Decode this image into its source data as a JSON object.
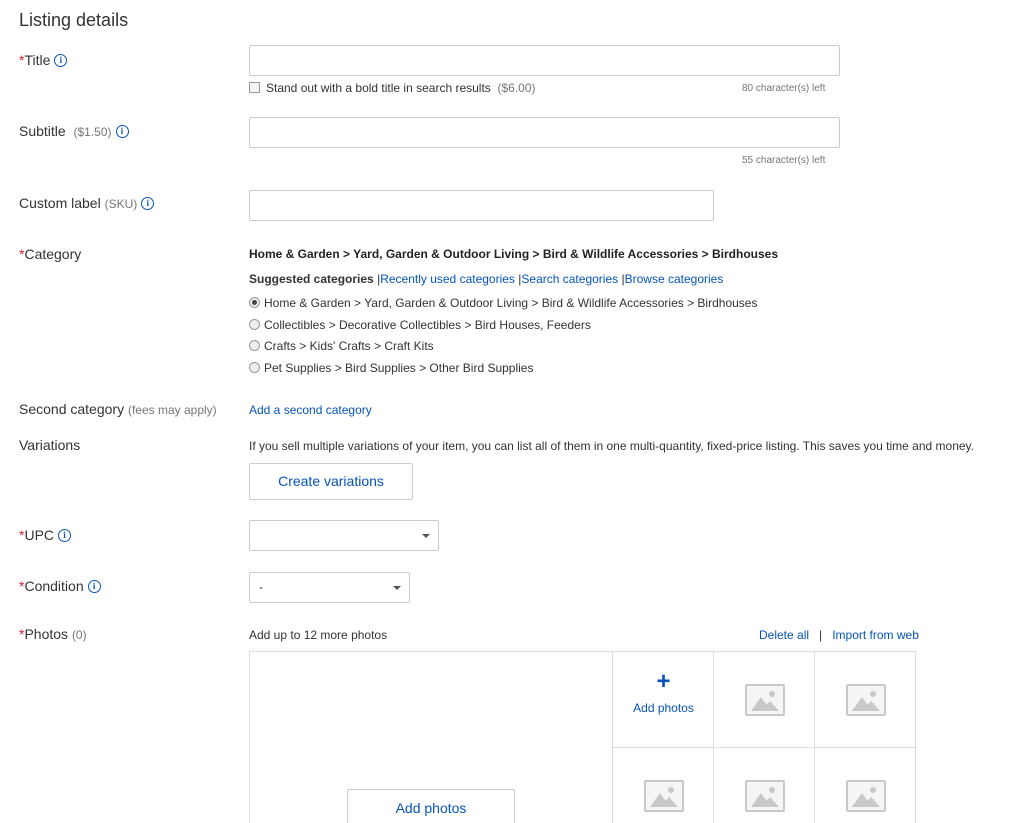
{
  "section_title": "Listing details",
  "required_mark": "*",
  "info_glyph": "i",
  "title": {
    "label": "Title",
    "value": "",
    "bold_option": "Stand out with a bold title in search results",
    "bold_price": "($6.00)",
    "chars_left": "80 character(s) left"
  },
  "subtitle": {
    "label": "Subtitle",
    "price": "($1.50)",
    "value": "",
    "chars_left": "55 character(s) left"
  },
  "custom_label": {
    "label": "Custom label",
    "hint": "(SKU)",
    "value": ""
  },
  "category": {
    "label": "Category",
    "selected_path": "Home & Garden > Yard, Garden & Outdoor Living > Bird & Wildlife Accessories > Birdhouses",
    "tabs": [
      "Suggested categories",
      "Recently used categories",
      "Search categories",
      "Browse categories"
    ],
    "options": [
      "Home & Garden > Yard, Garden & Outdoor Living > Bird & Wildlife Accessories > Birdhouses",
      "Collectibles > Decorative Collectibles > Bird Houses, Feeders",
      "Crafts > Kids' Crafts > Craft Kits",
      "Pet Supplies > Bird Supplies > Other Bird Supplies"
    ],
    "selected_index": 0
  },
  "second_category": {
    "label": "Second category",
    "hint": "(fees may apply)",
    "link": "Add a second category"
  },
  "variations": {
    "label": "Variations",
    "description": "If you sell multiple variations of your item, you can list all of them in one multi-quantity, fixed-price listing. This saves you time and money.",
    "button": "Create variations"
  },
  "upc": {
    "label": "UPC",
    "value": ""
  },
  "condition": {
    "label": "Condition",
    "value": "-"
  },
  "photos": {
    "label": "Photos",
    "count": "(0)",
    "hint": "Add up to 12 more photos",
    "delete_all": "Delete all",
    "divider": "|",
    "import_web": "Import from web",
    "add_small_plus": "+",
    "add_small": "Add photos",
    "add_main": "Add photos"
  },
  "colors": {
    "link": "#0654ba",
    "required": "#dd1e31",
    "border": "#cccccc"
  }
}
